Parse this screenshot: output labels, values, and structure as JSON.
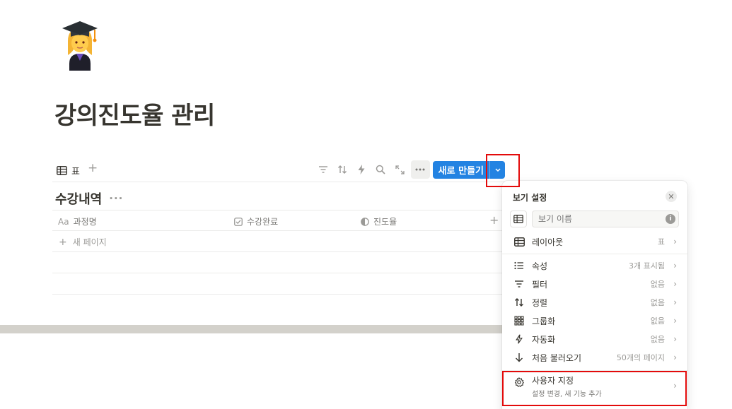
{
  "page": {
    "icon": "graduate-emoji-icon",
    "title": "강의진도율 관리"
  },
  "view_bar": {
    "tab_label": "표",
    "new_button_label": "새로 만들기"
  },
  "database": {
    "title": "수강내역",
    "columns": [
      {
        "label": "과정명",
        "icon": "text-aa-icon"
      },
      {
        "label": "수강완료",
        "icon": "checkbox-icon"
      },
      {
        "label": "진도율",
        "icon": "formula-icon"
      }
    ],
    "new_page_label": "새 페이지"
  },
  "view_settings": {
    "title": "보기 설정",
    "name_placeholder": "보기 이름",
    "layout": {
      "label": "레이아웃",
      "value": "표"
    },
    "items": [
      {
        "label": "속성",
        "value": "3개 표시됨",
        "icon": "list-icon"
      },
      {
        "label": "필터",
        "value": "없음",
        "icon": "filter-icon"
      },
      {
        "label": "정렬",
        "value": "없음",
        "icon": "sort-icon"
      },
      {
        "label": "그룹화",
        "value": "없음",
        "icon": "group-icon"
      },
      {
        "label": "자동화",
        "value": "없음",
        "icon": "lightning-icon"
      },
      {
        "label": "처음 불러오기",
        "value": "50개의 페이지",
        "icon": "arrow-down-icon"
      }
    ],
    "customize": {
      "label": "사용자 지정",
      "sublabel": "설정 변경, 새 기능 추가"
    }
  },
  "colors": {
    "accent": "#2383e2",
    "highlight": "#e30b0b",
    "text": "#37352f"
  }
}
